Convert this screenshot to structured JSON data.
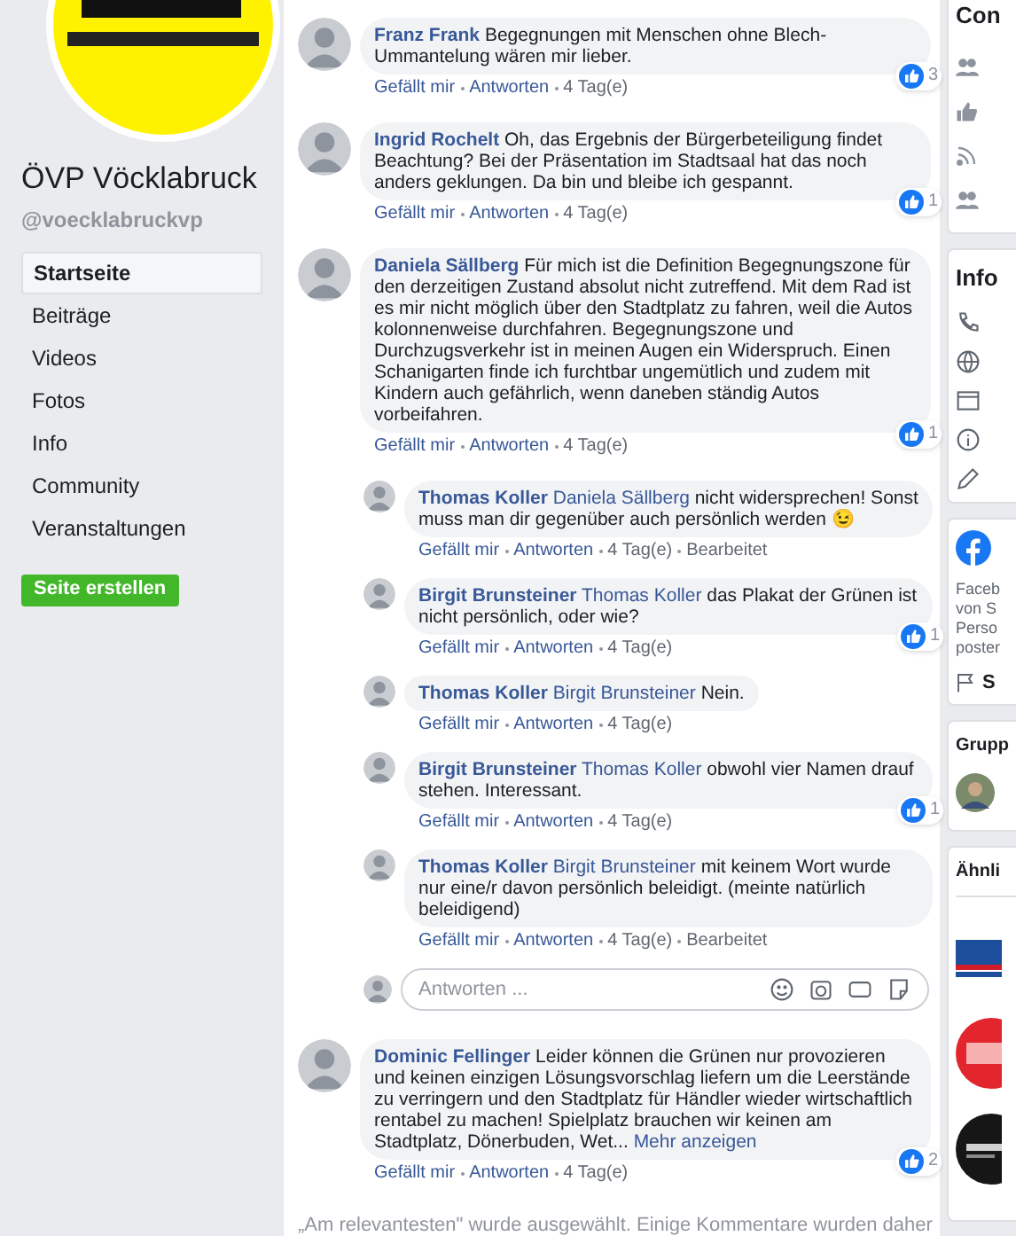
{
  "sidebar": {
    "page_name": "ÖVP Vöcklabruck",
    "handle": "@voecklabruckvp",
    "nav": [
      {
        "label": "Startseite",
        "selected": true
      },
      {
        "label": "Beiträge",
        "selected": false
      },
      {
        "label": "Videos",
        "selected": false
      },
      {
        "label": "Fotos",
        "selected": false
      },
      {
        "label": "Info",
        "selected": false
      },
      {
        "label": "Community",
        "selected": false
      },
      {
        "label": "Veranstaltungen",
        "selected": false
      }
    ],
    "create_button": "Seite erstellen"
  },
  "comments": [
    {
      "author": "Franz Frank",
      "text": "Begegnungen mit Menschen ohne Blech-Ummantelung wären mir lieber.",
      "like": "Gefällt mir",
      "reply": "Antworten",
      "time": "4 Tag(e)",
      "likes": "3"
    },
    {
      "author": "Ingrid Rochelt",
      "text": "Oh, das Ergebnis der Bürgerbeteiligung findet Beachtung? Bei der Präsentation im Stadtsaal hat das noch anders geklungen. Da bin und bleibe ich gespannt.",
      "like": "Gefällt mir",
      "reply": "Antworten",
      "time": "4 Tag(e)",
      "likes": "1"
    },
    {
      "author": "Daniela Sällberg",
      "text": "Für mich ist die Definition Begegnungszone für den derzeitigen Zustand absolut nicht zutreffend. Mit dem Rad ist es mir nicht möglich über den Stadtplatz zu fahren, weil die Autos kolonnenweise durchfahren. Begegnungszone und Durchzugsverkehr ist in meinen Augen ein Widerspruch. Einen Schanigarten finde ich furchtbar ungemütlich und zudem mit Kindern auch gefährlich, wenn daneben ständig Autos vorbeifahren.",
      "like": "Gefällt mir",
      "reply": "Antworten",
      "time": "4 Tag(e)",
      "likes": "1",
      "replies": [
        {
          "author": "Thomas Koller",
          "mention": "Daniela Sällberg",
          "text": "nicht widersprechen! Sonst muss man dir gegenüber auch persönlich werden 😉",
          "like": "Gefällt mir",
          "reply": "Antworten",
          "time": "4 Tag(e)",
          "edited": "Bearbeitet"
        },
        {
          "author": "Birgit Brunsteiner",
          "mention": "Thomas Koller",
          "text": "das Plakat der Grünen ist nicht persönlich, oder wie?",
          "like": "Gefällt mir",
          "reply": "Antworten",
          "time": "4 Tag(e)",
          "likes": "1"
        },
        {
          "author": "Thomas Koller",
          "mention": "Birgit Brunsteiner",
          "text": "Nein.",
          "like": "Gefällt mir",
          "reply": "Antworten",
          "time": "4 Tag(e)"
        },
        {
          "author": "Birgit Brunsteiner",
          "mention": "Thomas Koller",
          "text": "obwohl vier Namen drauf stehen. Interessant.",
          "like": "Gefällt mir",
          "reply": "Antworten",
          "time": "4 Tag(e)",
          "likes": "1"
        },
        {
          "author": "Thomas Koller",
          "mention": "Birgit Brunsteiner",
          "text": "mit keinem Wort wurde nur eine/r davon persönlich beleidigt. (meinte natürlich beleidigend)",
          "like": "Gefällt mir",
          "reply": "Antworten",
          "time": "4 Tag(e)",
          "edited": "Bearbeitet"
        }
      ],
      "reply_box": {
        "placeholder": "Antworten ..."
      }
    },
    {
      "author": "Dominic Fellinger",
      "text": "Leider können die Grünen nur provozieren und keinen einzigen Lösungsvorschlag liefern um die Leerstände zu verringern und den Stadtplatz für Händler wieder wirtschaftlich rentabel zu machen! Spielplatz brauchen wir keinen am Stadtplatz, Dönerbuden, Wet...",
      "more": "Mehr anzeigen",
      "like": "Gefällt mir",
      "reply": "Antworten",
      "time": "4 Tag(e)",
      "likes": "2"
    }
  ],
  "footer_note": "„Am relevantesten\" wurde ausgewählt. Einige Kommentare wurden daher",
  "right_cards": [
    {
      "kind": "community",
      "title": "Con"
    },
    {
      "kind": "info",
      "title": "Info"
    },
    {
      "kind": "transparency",
      "lines": [
        "Faceb",
        "von S",
        "Perso",
        "poster"
      ],
      "link": "S"
    },
    {
      "kind": "groups",
      "title": "Grupp"
    },
    {
      "kind": "similar",
      "title": "Ähnli"
    }
  ]
}
